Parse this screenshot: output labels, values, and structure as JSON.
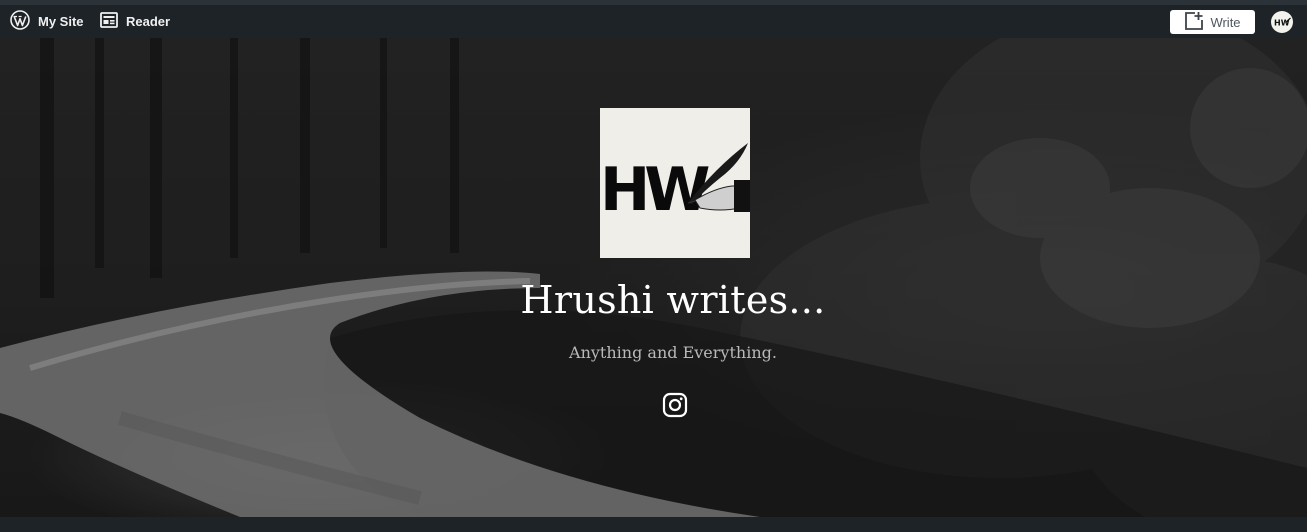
{
  "adminbar": {
    "my_site_label": "My Site",
    "reader_label": "Reader",
    "write_label": "Write",
    "avatar_text": "HW"
  },
  "site": {
    "title": "Hrushi writes...",
    "tagline": "Anything and Everything.",
    "logo_text": "HW"
  },
  "social": {
    "icon": "instagram-icon"
  },
  "colors": {
    "adminbar_bg": "#1d2327",
    "title": "#ffffff",
    "tagline": "#b9b9b9"
  }
}
